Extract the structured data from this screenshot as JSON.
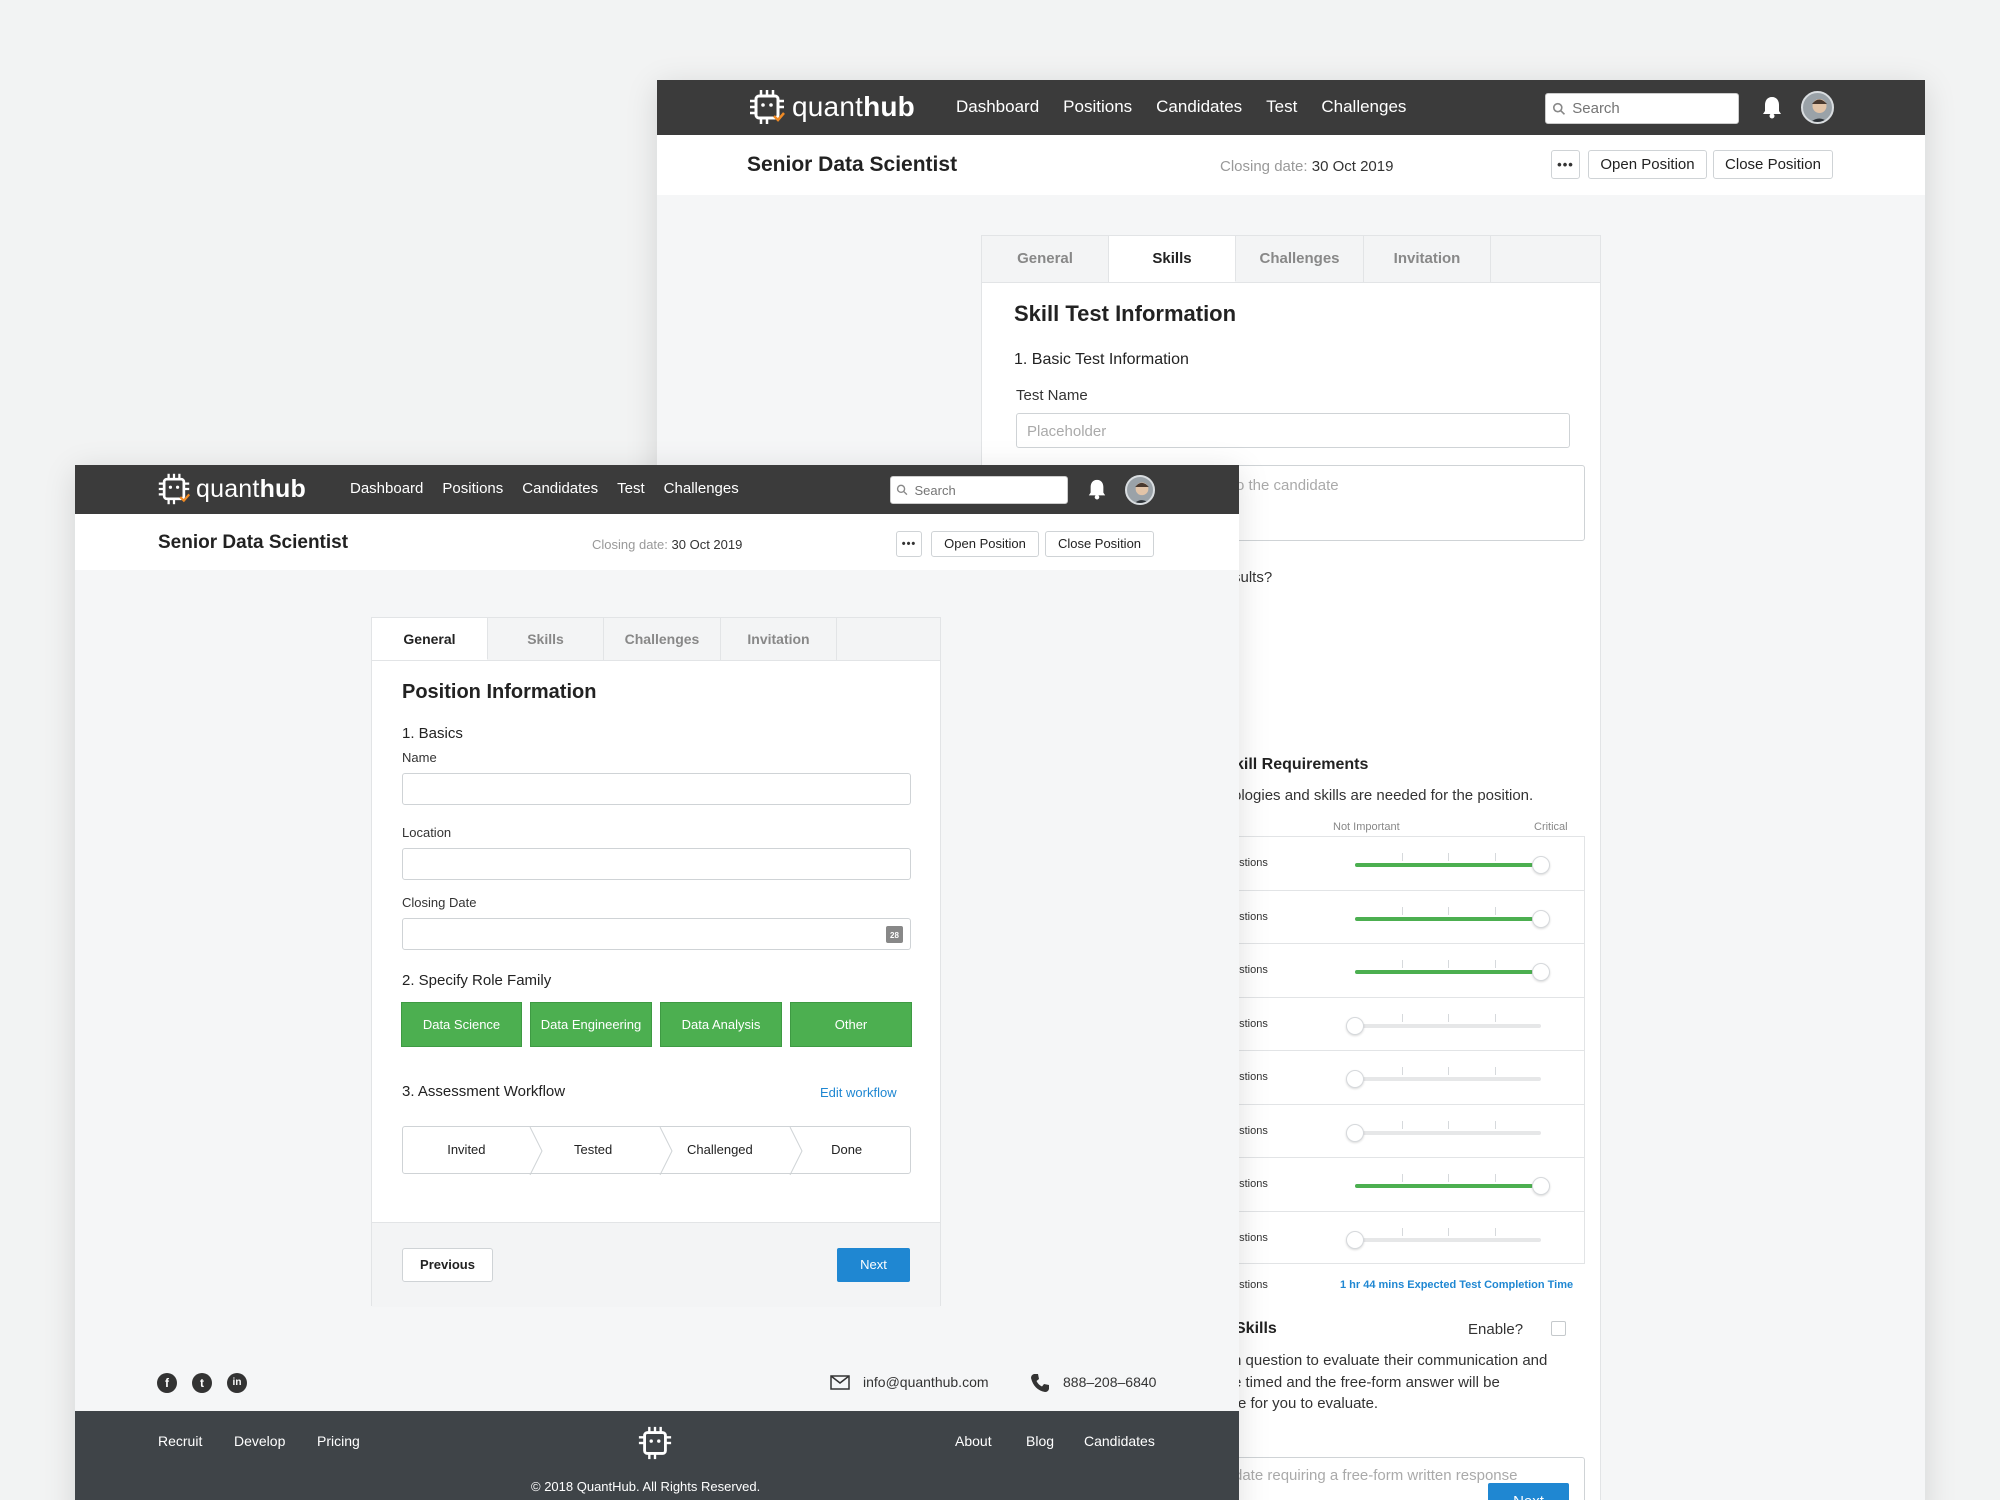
{
  "app": {
    "logo_light": "quant",
    "logo_bold": "hub"
  },
  "nav": {
    "links": [
      "Dashboard",
      "Positions",
      "Candidates",
      "Test",
      "Challenges"
    ],
    "search_placeholder": "Search"
  },
  "header": {
    "title": "Senior Data Scientist",
    "closing_label": "Closing date:",
    "closing_value": "30 Oct 2019",
    "more": "•••",
    "open_position": "Open Position",
    "close_position": "Close Position"
  },
  "tabs": [
    "General",
    "Skills",
    "Challenges",
    "Invitation"
  ],
  "skills_page": {
    "heading": "Skill Test Information",
    "section1": "1. Basic Test Information",
    "test_name_label": "Test Name",
    "test_name_placeholder": "Placeholder",
    "textarea_placeholder": "o the candidate",
    "results_q": "sults?",
    "section2": "kill Requirements",
    "section2_desc": "ologies and skills are needed for the position.",
    "scale_low": "Not Important",
    "scale_high": "Critical",
    "skills": [
      {
        "label": "estions",
        "level": 1
      },
      {
        "label": "estions",
        "level": 1
      },
      {
        "label": "estions",
        "level": 1
      },
      {
        "label": "estions",
        "level": 0
      },
      {
        "label": "estions",
        "level": 0
      },
      {
        "label": "estions",
        "level": 0
      },
      {
        "label": "estions",
        "level": 1
      },
      {
        "label": "estions",
        "level": 0
      }
    ],
    "total_label": "estions",
    "completion_time": "1 hr 44 mins Expected Test Completion Time",
    "section3": "Skills",
    "enable_label": "Enable?",
    "section3_desc_1": "n question to evaluate their communication and",
    "section3_desc_2": "e timed and the free-form answer will be",
    "section3_desc_3": "re for you to evaluate.",
    "freeform_placeholder": "date requiring a free-form written response",
    "next": "Next"
  },
  "general_page": {
    "heading": "Position Information",
    "section1": "1. Basics",
    "name_label": "Name",
    "location_label": "Location",
    "closing_date_label": "Closing Date",
    "calendar_day": "28",
    "section2": "2. Specify Role Family",
    "roles": [
      "Data Science",
      "Data Engineering",
      "Data Analysis",
      "Other"
    ],
    "section3": "3. Assessment Workflow",
    "edit_workflow": "Edit workflow",
    "workflow": [
      "Invited",
      "Tested",
      "Challenged",
      "Done"
    ],
    "previous": "Previous",
    "next": "Next"
  },
  "footer": {
    "email": "info@quanthub.com",
    "phone": "888–208–6840",
    "left_links": [
      "Recruit",
      "Develop",
      "Pricing"
    ],
    "right_links": [
      "About",
      "Blog",
      "Candidates"
    ],
    "copyright": "© 2018 QuantHub. All Rights Reserved."
  },
  "colors": {
    "nav_bg": "#3b3b3b",
    "accent_green": "#4caf50",
    "accent_blue": "#1f87d2",
    "footer_bg": "#3f4448"
  }
}
